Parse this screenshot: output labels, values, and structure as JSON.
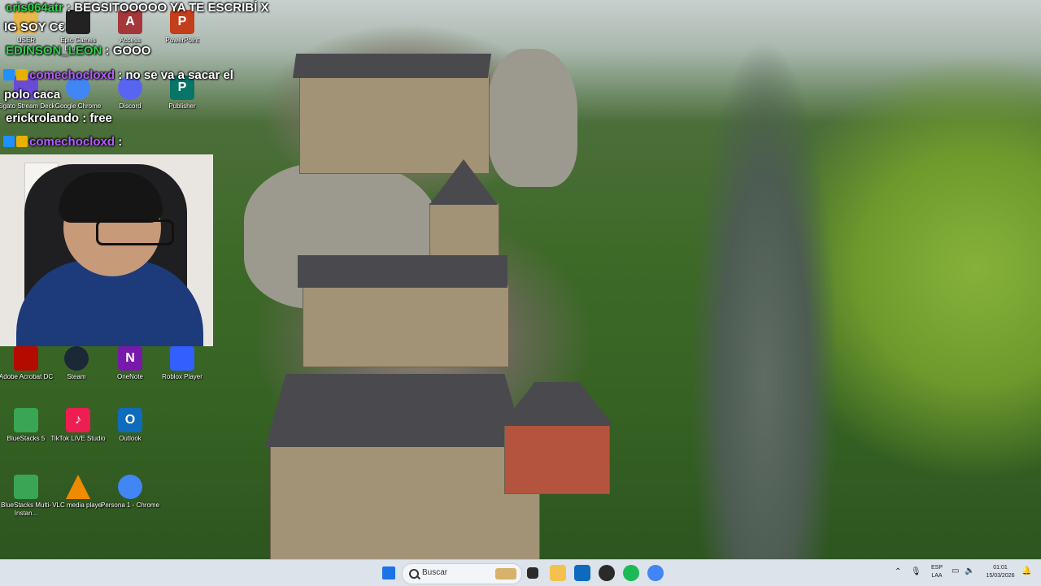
{
  "chat": [
    {
      "user": "cris064atr",
      "sep": " : ",
      "text": "BEGSITOOOOO YA TE ESCRIBÍ X"
    },
    {
      "user": "",
      "sep": "",
      "text": "IG SOY C€"
    },
    {
      "user": "EDINSON_LEON",
      "sep": " : ",
      "text": "GOOO"
    },
    {
      "user": "comechocloxd",
      "sep": " : ",
      "text": "no se va a sacar el"
    },
    {
      "user": "",
      "sep": "",
      "text": "polo caca"
    },
    {
      "user": "erickrolando",
      "sep": " : ",
      "text": "free"
    },
    {
      "user": "comechocloxd",
      "sep": " : ",
      "text": ""
    }
  ],
  "desktop_icons": [
    {
      "label": "USER",
      "icon": "folder-icon",
      "color": "#e8b84a"
    },
    {
      "label": "Epic Games Launcher",
      "icon": "epic-games-icon",
      "color": "#222222"
    },
    {
      "label": "Access",
      "icon": "access-icon",
      "color": "#a4373a"
    },
    {
      "label": "PowerPoint",
      "icon": "powerpoint-icon",
      "color": "#c43e1c"
    },
    {
      "label": "Elgato Stream Deck",
      "icon": "stream-deck-icon",
      "color": "#6a4bd6"
    },
    {
      "label": "Google Chrome",
      "icon": "chrome-icon",
      "color": "#4285f4"
    },
    {
      "label": "Discord",
      "icon": "discord-icon",
      "color": "#5865f2"
    },
    {
      "label": "Publisher",
      "icon": "publisher-icon",
      "color": "#077568"
    },
    {
      "label": "Adobe Acrobat DC",
      "icon": "acrobat-icon",
      "color": "#b30b00"
    },
    {
      "label": "Steam",
      "icon": "steam-icon",
      "color": "#1b2838"
    },
    {
      "label": "OneNote",
      "icon": "onenote-icon",
      "color": "#7719aa"
    },
    {
      "label": "Roblox Player",
      "icon": "roblox-icon",
      "color": "#335fff"
    },
    {
      "label": "BlueStacks 5",
      "icon": "bluestacks-icon",
      "color": "#3aa655"
    },
    {
      "label": "TikTok LIVE Studio",
      "icon": "tiktok-icon",
      "color": "#ee1d52"
    },
    {
      "label": "Outlook",
      "icon": "outlook-icon",
      "color": "#0f6cbd"
    },
    {
      "label": "BlueStacks Multi-Instan...",
      "icon": "bluestacks-multi-icon",
      "color": "#3aa655"
    },
    {
      "label": "VLC media player",
      "icon": "vlc-icon",
      "color": "#f08a00"
    },
    {
      "label": "Persona 1 - Chrome",
      "icon": "chrome-profile-icon",
      "color": "#4285f4"
    }
  ],
  "taskbar": {
    "search_placeholder": "Buscar",
    "language": "ESP",
    "layout": "LAA",
    "time": "01:01",
    "date": "15/03/2026"
  }
}
